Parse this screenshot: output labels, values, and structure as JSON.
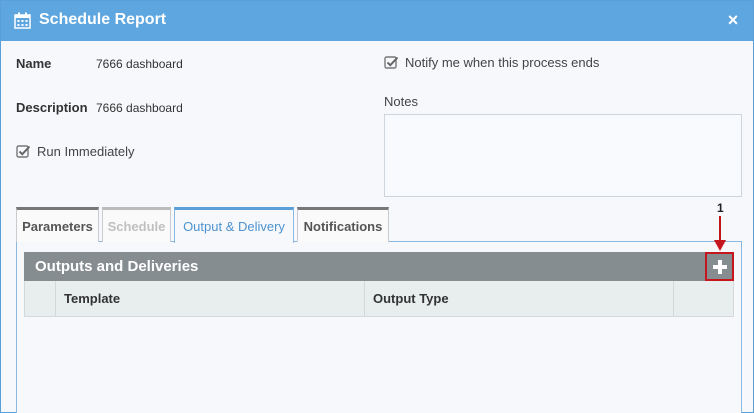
{
  "dialog": {
    "title": "Schedule Report",
    "close_label": "×"
  },
  "form": {
    "name_label": "Name",
    "name_value": "7666 dashboard",
    "description_label": "Description",
    "description_value": "7666 dashboard",
    "run_immediately_label": "Run Immediately",
    "run_immediately_checked": true,
    "notify_label": "Notify me when this process ends",
    "notify_checked": true,
    "notes_label": "Notes",
    "notes_value": ""
  },
  "tabs": [
    {
      "label": "Parameters",
      "state": "normal"
    },
    {
      "label": "Schedule",
      "state": "disabled"
    },
    {
      "label": "Output & Delivery",
      "state": "active"
    },
    {
      "label": "Notifications",
      "state": "normal"
    }
  ],
  "outputs": {
    "section_title": "Outputs and Deliveries",
    "add_icon": "plus-icon",
    "columns": [
      "Template",
      "Output Type"
    ],
    "rows": []
  },
  "callout": {
    "number": "1",
    "color": "#c4161c"
  },
  "colors": {
    "titlebar": "#5ea6e0",
    "section_header": "#868d90",
    "active_tab": "#4e93cf"
  }
}
